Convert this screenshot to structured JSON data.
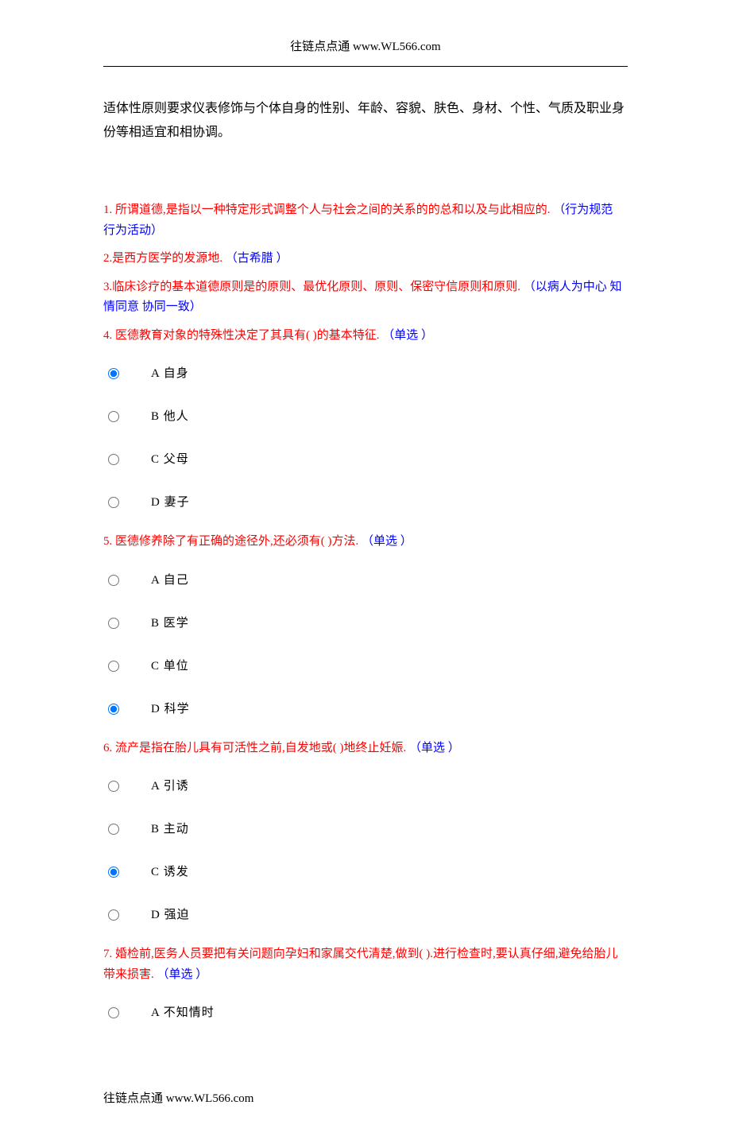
{
  "header": "往链点点通 www.WL566.com",
  "footer": "往链点点通 www.WL566.com",
  "intro": "适体性原则要求仪表修饰与个体自身的性别、年龄、容貌、肤色、身材、个性、气质及职业身份等相适宜和相协调。",
  "q1": {
    "num": "1.",
    "text": " 所谓道德,是指以一种特定形式调整个人与社会之间的关系的的总和以及与此相应的.",
    "hint": "（行为规范  行为活动）"
  },
  "q2": {
    "num": "2.",
    "text": "是西方医学的发源地.",
    "hint": "（古希腊 ）"
  },
  "q3": {
    "num": "3.",
    "text": "临床诊疗的基本道德原则是的原则、最优化原则、原则、保密守信原则和原则.",
    "hint": "（以病人为中心  知情同意  协同一致）"
  },
  "q4": {
    "num": "4.",
    "text": " 医德教育对象的特殊性决定了其具有( )的基本特征.",
    "hint": "（单选 ）",
    "options": [
      "A 自身",
      "B 他人",
      "C 父母",
      "D 妻子"
    ],
    "selected": 0
  },
  "q5": {
    "num": "5.",
    "text": " 医德修养除了有正确的途径外,还必须有( )方法.",
    "hint": "（单选 ）",
    "options": [
      "A 自己",
      "B 医学",
      "C 单位",
      "D 科学"
    ],
    "selected": 3
  },
  "q6": {
    "num": "6.",
    "text": " 流产是指在胎儿具有可活性之前,自发地或( )地终止妊娠.",
    "hint": "（单选 ）",
    "options": [
      "A 引诱",
      "B 主动",
      "C 诱发",
      "D 强迫"
    ],
    "selected": 2
  },
  "q7": {
    "num": "7.",
    "text": " 婚检前,医务人员要把有关问题向孕妇和家属交代清楚,做到( ).进行检查时,要认真仔细,避免给胎儿带来损害.",
    "hint": "（单选 ）",
    "options": [
      "A 不知情时"
    ],
    "selected": -1
  }
}
